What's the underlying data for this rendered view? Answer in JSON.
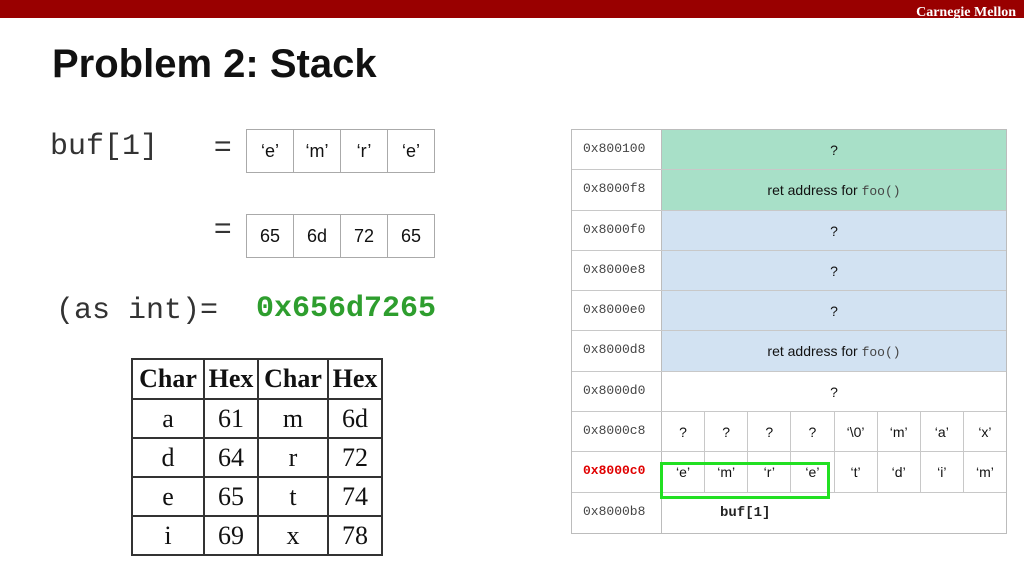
{
  "header": {
    "brand": "Carnegie Mellon"
  },
  "slide": {
    "title": "Problem 2: Stack",
    "buf_label": "buf[1]",
    "eq1": "=",
    "eq2": "=",
    "chars": [
      "‘e’",
      "‘m’",
      "‘r’",
      "‘e’"
    ],
    "hexbytes": [
      "65",
      "6d",
      "72",
      "65"
    ],
    "as_int_label": "(as int)=",
    "as_int_value": "0x656d7265",
    "as_int_color": "#2e9e2e"
  },
  "hex_table": {
    "headers": [
      "Char",
      "Hex",
      "Char",
      "Hex"
    ],
    "rows": [
      [
        "a",
        "61",
        "m",
        "6d"
      ],
      [
        "d",
        "64",
        "r",
        "72"
      ],
      [
        "e",
        "65",
        "t",
        "74"
      ],
      [
        "i",
        "69",
        "x",
        "78"
      ]
    ]
  },
  "memory": {
    "rows": [
      {
        "addr": "0x800100",
        "value": "?",
        "color": "#a8e0c8"
      },
      {
        "addr": "0x8000f8",
        "value": "ret address for ",
        "code": "foo()",
        "color": "#a8e0c8"
      },
      {
        "addr": "0x8000f0",
        "value": "?",
        "color": "#d2e2f2"
      },
      {
        "addr": "0x8000e8",
        "value": "?",
        "color": "#d2e2f2"
      },
      {
        "addr": "0x8000e0",
        "value": "?",
        "color": "#d2e2f2"
      },
      {
        "addr": "0x8000d8",
        "value": "ret address for ",
        "code": "foo()",
        "color": "#d2e2f2"
      },
      {
        "addr": "0x8000d0",
        "value": "?",
        "color": "#ffffff"
      },
      {
        "addr": "0x8000c8",
        "cells": [
          "?",
          "?",
          "?",
          "?",
          "‘\\0’",
          "‘m’",
          "‘a’",
          "‘x’"
        ],
        "color": "#ffffff"
      },
      {
        "addr": "0x8000c0",
        "cells": [
          "‘e’",
          "‘m’",
          "‘r’",
          "‘e’",
          "‘t’",
          "‘d’",
          "‘i’",
          "‘m’"
        ],
        "color": "#ffffff",
        "highlight": true
      },
      {
        "addr": "0x8000b8",
        "value": "",
        "color": "#ffffff"
      }
    ],
    "buf_label": "buf[1]",
    "highlight_color": "#22e022",
    "addr_highlight_color": "#e00000"
  }
}
